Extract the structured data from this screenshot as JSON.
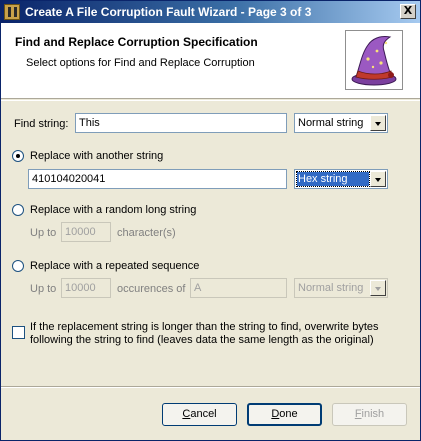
{
  "window": {
    "title": "Create A File Corruption Fault Wizard - Page 3 of 3",
    "close_glyph": "X"
  },
  "header": {
    "title": "Find and Replace Corruption Specification",
    "subtitle": "Select options for Find and Replace Corruption",
    "image_icon": "wizard-hat-icon"
  },
  "find": {
    "label": "Find string:",
    "value": "This",
    "type": "Normal string"
  },
  "replace_another": {
    "label": "Replace with another string",
    "checked": true,
    "value": "410104020041",
    "type": "Hex string"
  },
  "replace_random": {
    "label": "Replace with a random long string",
    "checked": false,
    "up_to": "Up to",
    "count": "10000",
    "unit": "character(s)"
  },
  "replace_repeated": {
    "label": "Replace with a repeated sequence",
    "checked": false,
    "up_to": "Up to",
    "count": "10000",
    "occurrences_of": "occurences of",
    "sequence": "A",
    "type": "Normal string"
  },
  "overwrite": {
    "line1": "If the replacement string is longer than the string to find, overwrite bytes",
    "line2": "following the string to find (leaves data the same length as the original)",
    "checked": false
  },
  "buttons": {
    "cancel_first": "C",
    "cancel_rest": "ancel",
    "done_first": "D",
    "done_rest": "one",
    "finish_first": "F",
    "finish_rest": "inish"
  },
  "colors": {
    "titlebar": "#0a246a",
    "dialog_bg": "#ece9d8",
    "selection": "#316ac5"
  }
}
